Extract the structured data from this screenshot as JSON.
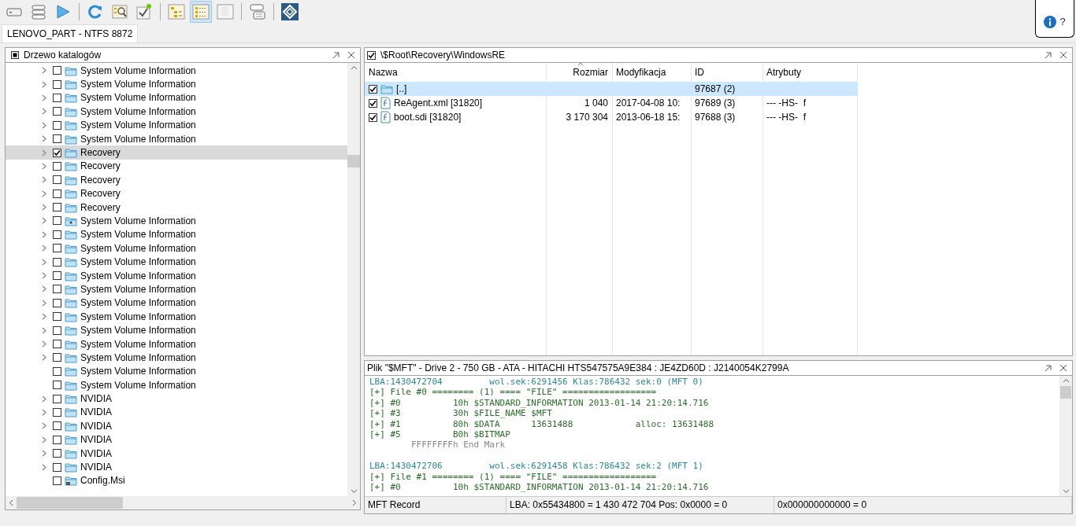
{
  "toolbar": [
    {
      "pressed": false
    },
    {
      "pressed": false
    },
    {
      "pressed": false
    },
    {
      "kind": "separator"
    },
    {
      "pressed": false
    },
    {
      "pressed": false
    },
    {
      "pressed": false
    },
    {
      "kind": "separator"
    },
    {
      "pressed": false
    },
    {
      "pressed": true
    },
    {
      "pressed": false
    },
    {
      "kind": "separator"
    },
    {
      "pressed": false
    },
    {
      "kind": "separator"
    },
    {
      "pressed": false
    }
  ],
  "help": {
    "label": "?"
  },
  "tabs": [
    {
      "label": "LENOVO_PART - NTFS 8872",
      "selected": true
    }
  ],
  "tree": {
    "title": "Drzewo katalogów",
    "items": [
      {
        "label": "System Volume Information",
        "expandable": true,
        "checked": false,
        "selected": false
      },
      {
        "label": "System Volume Information",
        "expandable": true,
        "checked": false,
        "selected": false
      },
      {
        "label": "System Volume Information",
        "expandable": true,
        "checked": false,
        "selected": false
      },
      {
        "label": "System Volume Information",
        "expandable": true,
        "checked": false,
        "selected": false
      },
      {
        "label": "System Volume Information",
        "expandable": true,
        "checked": false,
        "selected": false
      },
      {
        "label": "System Volume Information",
        "expandable": true,
        "checked": false,
        "selected": false
      },
      {
        "label": "Recovery",
        "expandable": true,
        "checked": true,
        "selected": true
      },
      {
        "label": "Recovery",
        "expandable": true,
        "checked": false,
        "selected": false
      },
      {
        "label": "Recovery",
        "expandable": true,
        "checked": false,
        "selected": false
      },
      {
        "label": "Recovery",
        "expandable": true,
        "checked": false,
        "selected": false
      },
      {
        "label": "Recovery",
        "expandable": true,
        "checked": false,
        "selected": false
      },
      {
        "kind": "marked",
        "label": "System Volume Information",
        "expandable": true,
        "checked": false,
        "selected": false
      },
      {
        "label": "System Volume Information",
        "expandable": true,
        "checked": false,
        "selected": false
      },
      {
        "label": "System Volume Information",
        "expandable": true,
        "checked": false,
        "selected": false
      },
      {
        "label": "System Volume Information",
        "expandable": true,
        "checked": false,
        "selected": false
      },
      {
        "label": "System Volume Information",
        "expandable": true,
        "checked": false,
        "selected": false
      },
      {
        "label": "System Volume Information",
        "expandable": true,
        "checked": false,
        "selected": false
      },
      {
        "label": "System Volume Information",
        "expandable": true,
        "checked": false,
        "selected": false
      },
      {
        "label": "System Volume Information",
        "expandable": true,
        "checked": false,
        "selected": false
      },
      {
        "label": "System Volume Information",
        "expandable": true,
        "checked": false,
        "selected": false
      },
      {
        "label": "System Volume Information",
        "expandable": true,
        "checked": false,
        "selected": false
      },
      {
        "label": "System Volume Information",
        "expandable": true,
        "checked": false,
        "selected": false
      },
      {
        "label": "System Volume Information",
        "expandable": false,
        "checked": false,
        "selected": false
      },
      {
        "label": "System Volume Information",
        "expandable": false,
        "checked": false,
        "selected": false
      },
      {
        "label": "NVIDIA",
        "expandable": true,
        "checked": false,
        "selected": false
      },
      {
        "label": "NVIDIA",
        "expandable": true,
        "checked": false,
        "selected": false
      },
      {
        "label": "NVIDIA",
        "expandable": true,
        "checked": false,
        "selected": false
      },
      {
        "label": "NVIDIA",
        "expandable": true,
        "checked": false,
        "selected": false
      },
      {
        "label": "NVIDIA",
        "expandable": true,
        "checked": false,
        "selected": false
      },
      {
        "label": "NVIDIA",
        "expandable": true,
        "checked": false,
        "selected": false
      },
      {
        "kind": "locked",
        "label": "Config.Msi",
        "expandable": false,
        "checked": false,
        "selected": false
      }
    ]
  },
  "files": {
    "path": "\\$Root\\Recovery\\WindowsRE",
    "path_checked": true,
    "columns": [
      {
        "label": "Nazwa",
        "sorted": false
      },
      {
        "label": "Rozmiar",
        "sorted": true
      },
      {
        "label": "Modyfikacja",
        "sorted": false
      },
      {
        "label": "ID",
        "sorted": false
      },
      {
        "label": "Atrybuty",
        "sorted": false
      }
    ],
    "rows": [
      {
        "kind": "folder",
        "checked": true,
        "selected": true,
        "name": "[..]",
        "id": "97687 (2)"
      },
      {
        "kind": "file",
        "checked": true,
        "selected": false,
        "name": "ReAgent.xml [31820]",
        "size": "1 040",
        "modified": "2017-04-08 10:",
        "id": "97689 (3)",
        "attributes": "--- -HS-  f"
      },
      {
        "kind": "file",
        "checked": true,
        "selected": false,
        "name": "boot.sdi [31820]",
        "size": "3 170 304",
        "modified": "2013-06-18 15:",
        "id": "97688 (3)",
        "attributes": "--- -HS-  f"
      }
    ]
  },
  "record": {
    "title": "Plik \"$MFT\" - Drive 2 - 750 GB - ATA - HITACHI HTS547575A9E384 : JE4ZD60D : J2140054K2799A",
    "lines": [
      {
        "kind": "address",
        "text": "LBA:1430472704         wol.sek:6291456 Klas:786432 sek:0 (MFT 0)"
      },
      {
        "kind": "record",
        "text": "[+] File #0 ======== (1) ==== \"FILE\" =================="
      },
      {
        "kind": "record",
        "text": "[+] #0          10h $STANDARD_INFORMATION 2013-01-14 21:20:14.716"
      },
      {
        "kind": "record",
        "text": "[+] #3          30h $FILE_NAME $MFT"
      },
      {
        "kind": "record",
        "text": "[+] #1          80h $DATA      13631488            alloc: 13631488"
      },
      {
        "kind": "record",
        "text": "[+] #5          B0h $BITMAP"
      },
      {
        "kind": "mark",
        "text": "        FFFFFFFFh End Mark"
      },
      {
        "kind": "blank"
      },
      {
        "kind": "address",
        "text": "LBA:1430472706         wol.sek:6291458 Klas:786432 sek:2 (MFT 1)"
      },
      {
        "kind": "record",
        "text": "[+] File #1 ======== (1) ==== \"FILE\" =================="
      },
      {
        "kind": "record",
        "text": "[+] #0          10h $STANDARD_INFORMATION 2013-01-14 21:20:14.716"
      }
    ],
    "status": [
      "MFT Record",
      "LBA: 0x55434800 = 1 430 472 704  Pos: 0x0000 = 0",
      "0x000000000000 = 0"
    ]
  }
}
